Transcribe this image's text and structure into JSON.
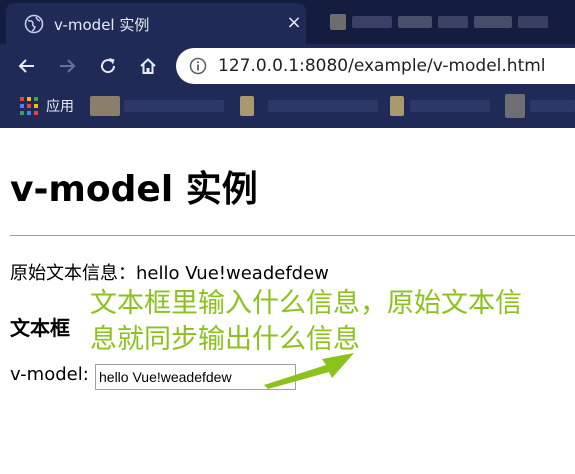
{
  "browser": {
    "tab_title": "v-model 实例",
    "tab_close": "×",
    "url": "127.0.0.1:8080/example/v-model.html",
    "bookmarks_apps_label": "应用",
    "icons": [
      "globe-icon",
      "back-arrow-icon",
      "forward-arrow-icon",
      "reload-icon",
      "home-icon",
      "info-icon",
      "apps-grid-icon"
    ]
  },
  "page": {
    "title": "v-model 实例",
    "original_line": "原始文本信息：hello Vue!weadefdew",
    "sub_heading": "文本框",
    "vmodel_label": "v-model:",
    "input_value": "hello Vue!weadefdew"
  },
  "annotation": {
    "line1": "文本框里输入什么信息，原始文本信",
    "line2": "息就同步输出什么信息",
    "color": "#8cc21e"
  },
  "colors": {
    "chrome_bg": "#1f2a56",
    "tabstrip_bg": "#141c3f"
  }
}
